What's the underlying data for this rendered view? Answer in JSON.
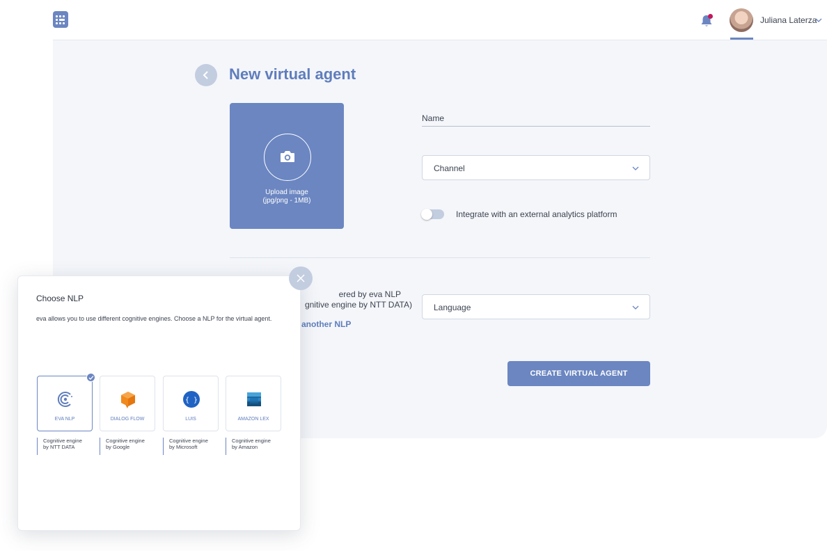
{
  "header": {
    "user_name": "Juliana Laterza"
  },
  "page": {
    "title": "New virtual agent",
    "upload": {
      "line1": "Upload image",
      "line2": "(jpg/png - 1MB)"
    },
    "name_label": "Name",
    "channel_placeholder": "Channel",
    "toggle_label": "Integrate with an external analytics platform",
    "nlp_powered_line1": "ered by eva NLP",
    "nlp_powered_line2": "gnitive engine by NTT DATA)",
    "nlp_link": "another NLP",
    "language_placeholder": "Language",
    "create_button": "CREATE VIRTUAL AGENT"
  },
  "modal": {
    "title": "Choose NLP",
    "description": "eva allows you to use different cognitive engines. Choose a NLP for the virtual agent.",
    "engines": [
      {
        "name": "EVA NLP",
        "desc_line1": "Cognitive engine",
        "desc_line2": "by NTT DATA",
        "icon": "eva-nlp-icon",
        "selected": true
      },
      {
        "name": "DIALOG FLOW",
        "desc_line1": "Cognitive engine",
        "desc_line2": "by Google",
        "icon": "dialogflow-icon",
        "selected": false
      },
      {
        "name": "LUIS",
        "desc_line1": "Cognitive engine",
        "desc_line2": "by Microsoft",
        "icon": "luis-icon",
        "selected": false
      },
      {
        "name": "AMAZON LEX",
        "desc_line1": "Cognitive engine",
        "desc_line2": "by Amazon",
        "icon": "amazon-lex-icon",
        "selected": false
      }
    ]
  },
  "colors": {
    "accent": "#6b86c1",
    "accent_text": "#5f7dbc",
    "notification_dot": "#c2185b",
    "page_background": "#f4f6fa"
  }
}
